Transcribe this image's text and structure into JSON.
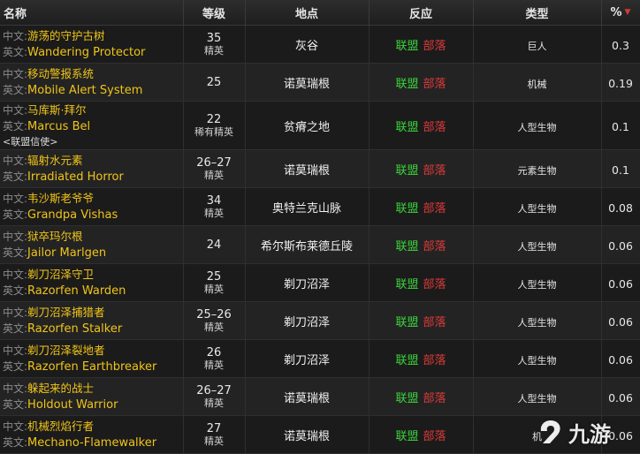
{
  "headers": {
    "name": "名称",
    "level": "等级",
    "location": "地点",
    "reaction": "反应",
    "type": "类型",
    "percent": "%"
  },
  "sort": {
    "column": "percent",
    "direction": "descending",
    "icon": "triangle-down-icon"
  },
  "prefix": {
    "cn": "中文:",
    "en": "英文:"
  },
  "reaction": {
    "alliance": "联盟",
    "horde": "部落"
  },
  "colors": {
    "name_text": "#f0c419",
    "alliance": "#3bd43b",
    "horde": "#e03a3a",
    "prefix": "#8a8a8a"
  },
  "rows": [
    {
      "cn": "游荡的守护古树",
      "en": "Wandering Protector",
      "level": "35",
      "classification": "精英",
      "location": "灰谷",
      "type": "巨人",
      "percent": "0.3"
    },
    {
      "cn": "移动警报系统",
      "en": "Mobile Alert System",
      "level": "25",
      "classification": "",
      "location": "诺莫瑞根",
      "type": "机械",
      "percent": "0.19"
    },
    {
      "cn": "马库斯·拜尔",
      "en": "Marcus Bel",
      "tag": "<联盟信使>",
      "level": "22",
      "classification": "稀有精英",
      "location": "贫瘠之地",
      "type": "人型生物",
      "percent": "0.1"
    },
    {
      "cn": "辐射水元素",
      "en": "Irradiated Horror",
      "level": "26–27",
      "classification": "精英",
      "location": "诺莫瑞根",
      "type": "元素生物",
      "percent": "0.1"
    },
    {
      "cn": "韦沙斯老爷爷",
      "en": "Grandpa Vishas",
      "level": "34",
      "classification": "精英",
      "location": "奥特兰克山脉",
      "type": "人型生物",
      "percent": "0.08"
    },
    {
      "cn": "狱卒玛尔根",
      "en": "Jailor Marlgen",
      "level": "24",
      "classification": "",
      "location": "希尔斯布莱德丘陵",
      "type": "人型生物",
      "percent": "0.06"
    },
    {
      "cn": "剃刀沼泽守卫",
      "en": "Razorfen Warden",
      "level": "25",
      "classification": "精英",
      "location": "剃刀沼泽",
      "type": "人型生物",
      "percent": "0.06"
    },
    {
      "cn": "剃刀沼泽捕猎者",
      "en": "Razorfen Stalker",
      "level": "25–26",
      "classification": "精英",
      "location": "剃刀沼泽",
      "type": "人型生物",
      "percent": "0.06"
    },
    {
      "cn": "剃刀沼泽裂地者",
      "en": "Razorfen Earthbreaker",
      "level": "26",
      "classification": "精英",
      "location": "剃刀沼泽",
      "type": "人型生物",
      "percent": "0.06"
    },
    {
      "cn": "躲起来的战士",
      "en": "Holdout Warrior",
      "level": "26–27",
      "classification": "精英",
      "location": "诺莫瑞根",
      "type": "人型生物",
      "percent": "0.06"
    },
    {
      "cn": "机械烈焰行者",
      "en": "Mechano-Flamewalker",
      "level": "27",
      "classification": "精英",
      "location": "诺莫瑞根",
      "type": "机",
      "percent": "0.06"
    }
  ],
  "watermark": {
    "text": "九游",
    "icon": "jiuyou-logo-icon"
  }
}
